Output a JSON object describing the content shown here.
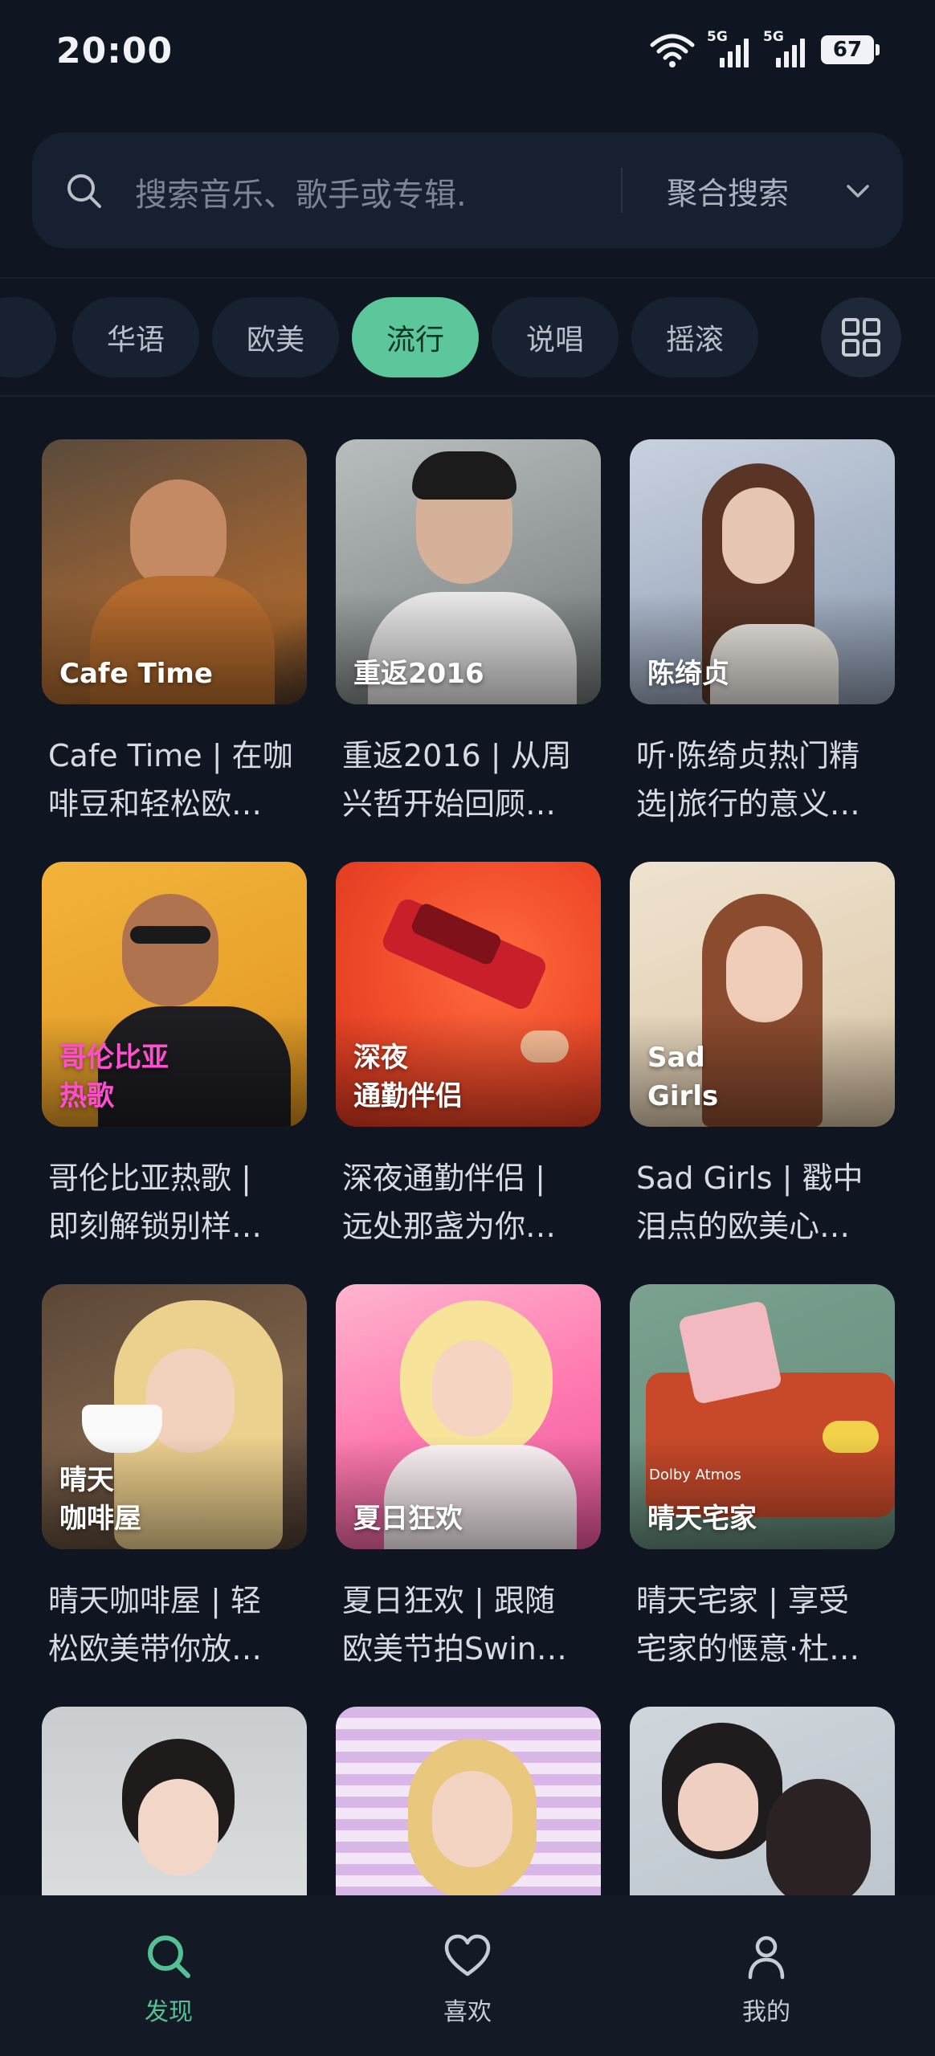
{
  "status_bar": {
    "time": "20:00",
    "signal1_label": "5G",
    "signal2_label": "5G",
    "battery": "67"
  },
  "search": {
    "placeholder": "搜索音乐、歌手或专辑.",
    "mode": "聚合搜索"
  },
  "categories": {
    "items": [
      "华语",
      "欧美",
      "流行",
      "说唱",
      "摇滚"
    ],
    "selected": "流行"
  },
  "cards": [
    {
      "overlay": "Cafe Time",
      "title": "Cafe Time | 在咖\n啡豆和轻松欧…"
    },
    {
      "overlay": "重返2016",
      "title": "重返2016 | 从周\n兴哲开始回顾…"
    },
    {
      "overlay": "陈绮贞",
      "title": "听·陈绮贞热门精\n选|旅行的意义…"
    },
    {
      "overlay": "哥伦比亚\n热歌",
      "title": "哥伦比亚热歌 |\n即刻解锁别样…"
    },
    {
      "overlay": "深夜\n通勤伴侣",
      "title": "深夜通勤伴侣 |\n远处那盏为你…"
    },
    {
      "overlay": "Sad\nGirls",
      "title": "Sad Girls | 戳中\n泪点的欧美心…"
    },
    {
      "overlay": "晴天\n咖啡屋",
      "title": "晴天咖啡屋 | 轻\n松欧美带你放…"
    },
    {
      "overlay": "夏日狂欢",
      "title": "夏日狂欢 | 跟随\n欧美节拍Swin…"
    },
    {
      "overlay": "晴天宅家",
      "badge": "Dolby Atmos",
      "title": "晴天宅家 | 享受\n宅家的惬意·杜…"
    }
  ],
  "bottom_nav": {
    "items": [
      {
        "label": "发现",
        "icon": "search-icon",
        "active": true
      },
      {
        "label": "喜欢",
        "icon": "heart-icon",
        "active": false
      },
      {
        "label": "我的",
        "icon": "person-icon",
        "active": false
      }
    ]
  },
  "colors": {
    "background": "#0f1521",
    "accent": "#5cc79a",
    "chip": "#182130"
  }
}
